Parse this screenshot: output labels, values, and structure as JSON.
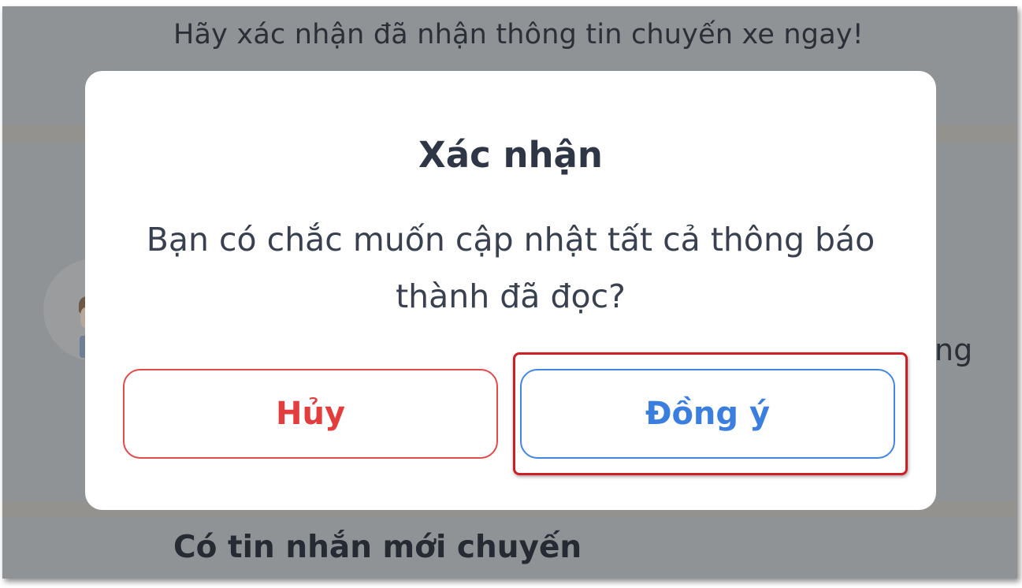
{
  "background": {
    "top_text": "Hãy xác nhận đã nhận thông tin chuyến xe ngay!",
    "right_partial_text": "ng",
    "bottom_text": "Có tin nhắn mới chuyến",
    "avatar_icon": "user-avatar-icon"
  },
  "dialog": {
    "title": "Xác nhận",
    "message": "Bạn có chắc muốn cập nhật tất cả thông báo thành đã đọc?",
    "cancel_label": "Hủy",
    "confirm_label": "Đồng ý"
  },
  "colors": {
    "overlay": "#8f9396",
    "cancel": "#e43d3d",
    "confirm": "#3a7fe0",
    "highlight": "#cf1f26"
  }
}
